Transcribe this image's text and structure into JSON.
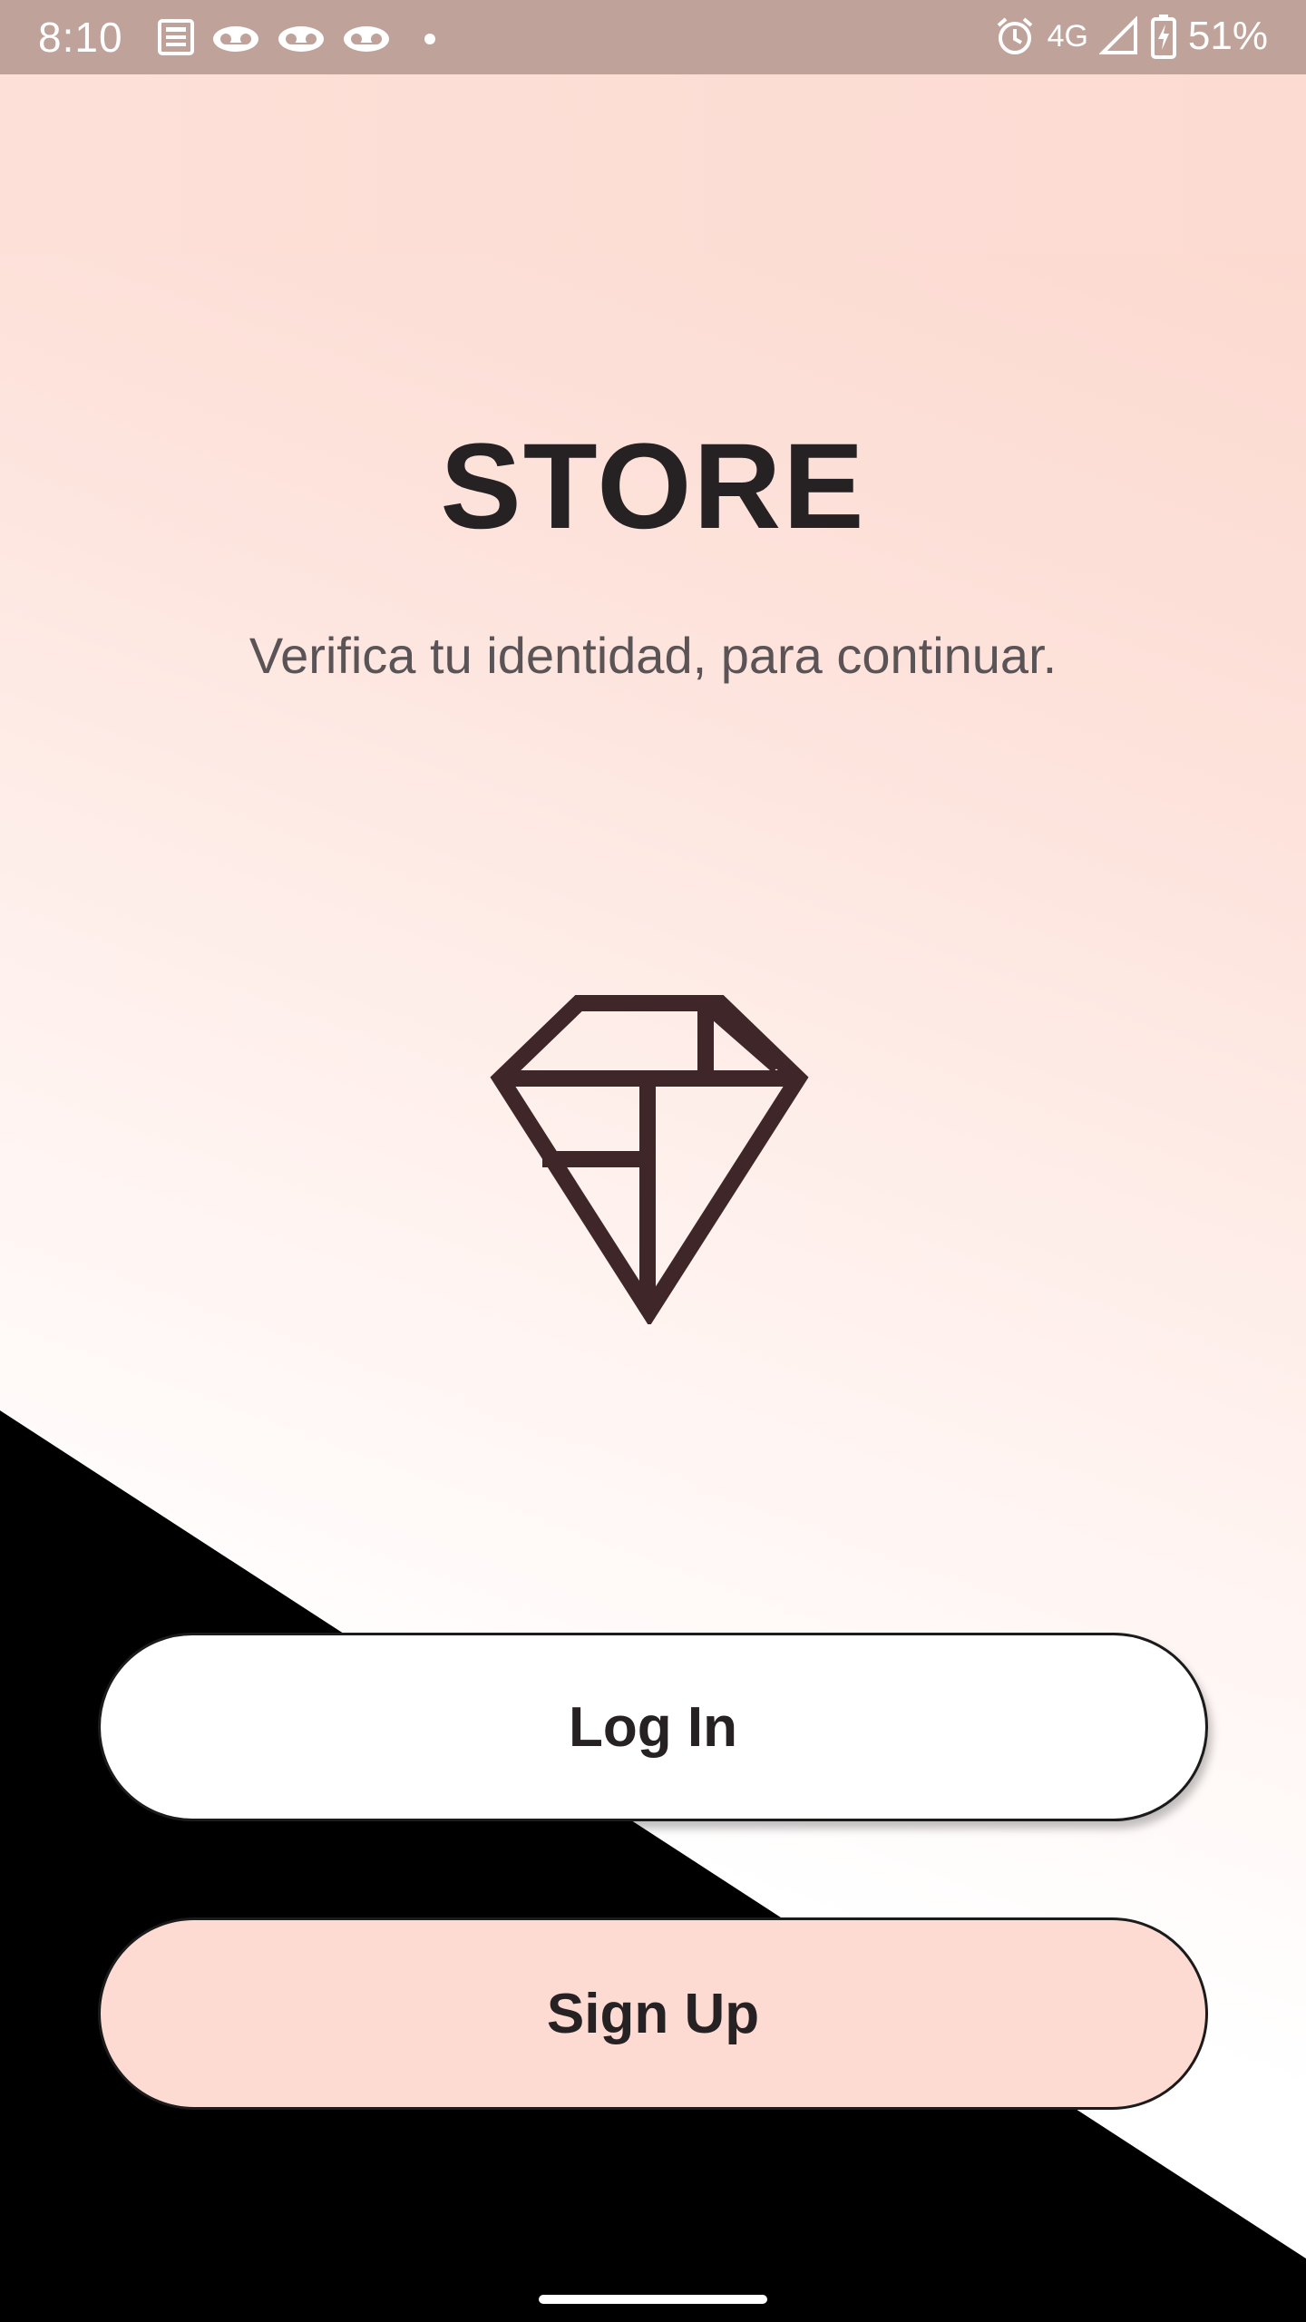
{
  "status_bar": {
    "time": "8:10",
    "network": "4G",
    "battery": "51%",
    "icons_left": [
      "news-icon",
      "voicemail-icon",
      "voicemail-icon",
      "voicemail-icon",
      "dot-icon"
    ],
    "icons_right": [
      "alarm-icon",
      "signal-icon",
      "battery-charging-icon"
    ]
  },
  "header": {
    "title": "STORE",
    "subtitle": "Verifica tu identidad, para continuar."
  },
  "logo": {
    "icon": "diamond-icon",
    "color": "#3f2628"
  },
  "actions": {
    "login_label": "Log In",
    "signup_label": "Sign Up"
  },
  "colors": {
    "accent": "#fddbd3",
    "status_bar": "#bfa39b",
    "text_dark": "#262123"
  }
}
